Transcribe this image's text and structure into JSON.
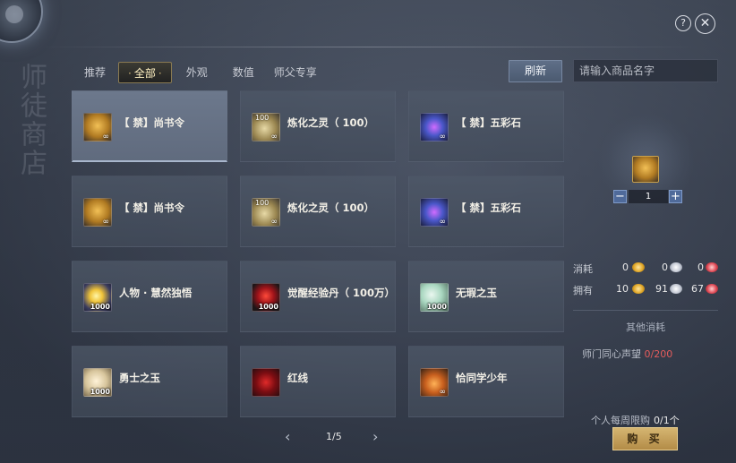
{
  "header": {
    "side_title": "师徒商店",
    "help_glyph": "?",
    "close_glyph": "✕"
  },
  "tabs": [
    {
      "label": "推荐",
      "active": false
    },
    {
      "label": "全部",
      "active": true
    },
    {
      "label": "外观",
      "active": false
    },
    {
      "label": "数值",
      "active": false
    },
    {
      "label": "师父专享",
      "active": false
    }
  ],
  "refresh_label": "刷新",
  "search": {
    "placeholder": "请输入商品名字"
  },
  "items": [
    {
      "name": "【 禁】尚书令",
      "icon": "token-icon",
      "qty": "∞"
    },
    {
      "name": "炼化之灵（ 100）",
      "icon": "spirit-icon",
      "qty": "∞",
      "stack": "100"
    },
    {
      "name": "【 禁】五彩石",
      "icon": "stone-icon",
      "qty": "∞"
    },
    {
      "name": "【 禁】尚书令",
      "icon": "token-icon",
      "qty": "∞"
    },
    {
      "name": "炼化之灵（ 100）",
      "icon": "spirit-icon",
      "qty": "∞",
      "stack": "100"
    },
    {
      "name": "【 禁】五彩石",
      "icon": "stone-icon",
      "qty": "∞"
    },
    {
      "name": "人物 · 慧然独悟",
      "icon": "star-icon",
      "qty": "1000"
    },
    {
      "name": "觉醒经验丹（ 100万）",
      "icon": "pill-icon",
      "qty": "1000"
    },
    {
      "name": "无瑕之玉",
      "icon": "jade-icon",
      "qty": "1000"
    },
    {
      "name": "勇士之玉",
      "icon": "jade-icon",
      "qty": "1000"
    },
    {
      "name": "红线",
      "icon": "thread-icon",
      "qty": ""
    },
    {
      "name": "恰同学少年",
      "icon": "book-icon",
      "qty": "∞"
    }
  ],
  "pager": {
    "prev": "‹",
    "page": "1/5",
    "next": "›"
  },
  "purchase": {
    "quantity": "1",
    "minus": "−",
    "plus": "+",
    "cost_label": "消耗",
    "own_label": "拥有",
    "cost": [
      "0",
      "0",
      "0"
    ],
    "own": [
      "10",
      "91",
      "67"
    ],
    "other_cost_label": "其他消耗",
    "reputation_label": "师门同心声望",
    "reputation_value": "0/200",
    "limit_label": "个人每周限购",
    "limit_value": "0/1个",
    "buy_label": "购 买"
  },
  "colors": {
    "accent_gold": "#d5b571",
    "reputation_red": "#e45c5c"
  }
}
